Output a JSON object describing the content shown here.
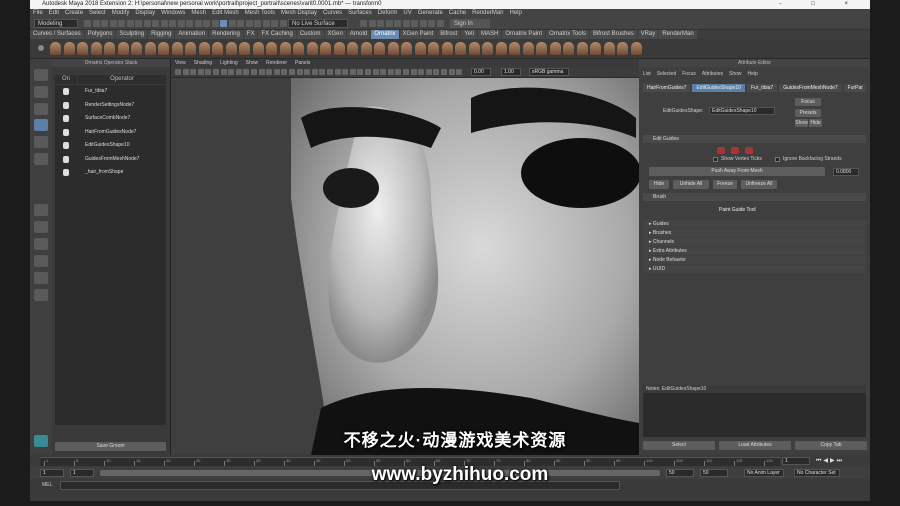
{
  "window": {
    "title": "Autodesk Maya 2018 Extension 2: H:\\personal\\new personal work\\portrait\\project_portrait\\scenes\\varit0.0001.mb* --- transform0",
    "controls": [
      "-",
      "□",
      "×"
    ]
  },
  "menubar": [
    "File",
    "Edit",
    "Create",
    "Select",
    "Modify",
    "Display",
    "Windows",
    "Mesh",
    "Edit Mesh",
    "Mesh Tools",
    "Mesh Display",
    "Curves",
    "Surfaces",
    "Deform",
    "UV",
    "Generate",
    "Cache",
    "RenderMan",
    "Help"
  ],
  "status": {
    "mode": "Modeling",
    "live": "No Live Surface",
    "signin": "Sign In"
  },
  "shelf_tabs": {
    "items": [
      "Curves / Surfaces",
      "Polygons",
      "Sculpting",
      "Rigging",
      "Animation",
      "Rendering",
      "FX",
      "FX Caching",
      "Custom",
      "XGen",
      "Arnold",
      "Ornatrix",
      "XGen Paint",
      "Bifrost",
      "Yeti",
      "MASH",
      "Ornatrix Paint",
      "Ornatrix Tools",
      "Bifrost Brushes",
      "VRay",
      "RenderMan"
    ],
    "active": "Ornatrix"
  },
  "outliner": {
    "title": "Ornatrix Operator Stack",
    "col_on": "On",
    "col_operator": "Operator",
    "items": [
      "Fur_tibia7",
      "RenderSettingsNode7",
      "SurfaceCombNode7",
      "HairFromGuidesNode7",
      "EditGuidesShape10",
      "GuidesFromMeshNode7",
      "_hair_fromShape"
    ],
    "save_button": "Save Groom"
  },
  "viewport": {
    "menu": [
      "View",
      "Shading",
      "Lighting",
      "Show",
      "Renderer",
      "Panels"
    ],
    "field1": "0.00",
    "field2": "1.00",
    "colorspace": "sRGB gamma"
  },
  "attribute_editor": {
    "title": "Attribute Editor",
    "menu": [
      "List",
      "Selected",
      "Focus",
      "Attributes",
      "Show",
      "Help"
    ],
    "tabs": [
      "HairFromGuides7",
      "EditGuidesShape10",
      "Fur_tibia7",
      "GuidesFromMeshNode7",
      "FurPar"
    ],
    "active_tab": "EditGuidesShape10",
    "node_label": "EditGuidesShape:",
    "node_value": "EditGuidesShape10",
    "side_buttons": [
      "Focus",
      "Presets",
      "Show",
      "Hide"
    ],
    "section_edit": "Edit Guides",
    "chk1": "Show Vertex Ticks",
    "chk2": "Ignore Backfacing Strands",
    "push_button": "Push Away From Mesh",
    "push_value": "0.0800",
    "row_buttons": [
      "Hide",
      "Unhide All",
      "Freeze",
      "Unfreeze All"
    ],
    "section_brush": "Brush",
    "paint_button": "Paint Guide Tool",
    "sections": [
      "Guides",
      "Brushes",
      "Channels",
      "Extra Attributes",
      "Node Behavior",
      "UUID"
    ],
    "notes": "Notes: EditGuidesShape10",
    "bottom_buttons": [
      "Select",
      "Load Attributes",
      "Copy Tab"
    ]
  },
  "timeline": {
    "ticks": [
      "1",
      "5",
      "10",
      "15",
      "20",
      "25",
      "30",
      "35",
      "40",
      "45",
      "50",
      "55",
      "60",
      "65",
      "70",
      "75",
      "80",
      "85",
      "90",
      "95",
      "100",
      "105",
      "110",
      "115",
      "120"
    ],
    "current": "1"
  },
  "range": {
    "start": "1",
    "start2": "1",
    "end": "50",
    "end2": "50",
    "value": "120",
    "anim_layer": "No Anim Layer",
    "char_set": "No Character Set",
    "fps": "24 fps"
  },
  "mel": {
    "label": "MEL"
  },
  "watermark": {
    "line1": "不移之火·动漫游戏美术资源",
    "line2": "www.byzhihuo.com"
  }
}
